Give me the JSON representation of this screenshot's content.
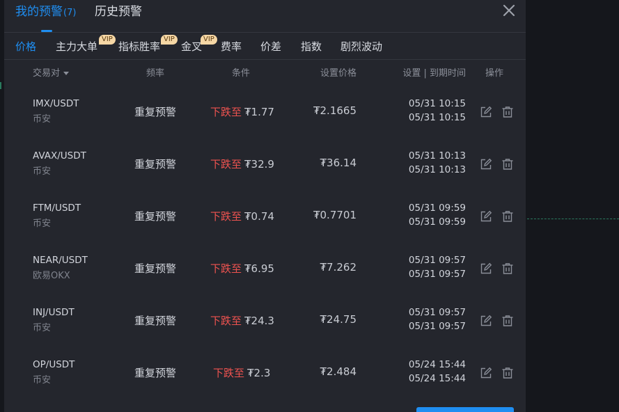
{
  "header": {
    "tabs": [
      {
        "label": "我的预警",
        "count": "(7)"
      },
      {
        "label": "历史预警"
      }
    ]
  },
  "subtabs": [
    {
      "label": "价格",
      "vip": ""
    },
    {
      "label": "主力大单",
      "vip": "VIP"
    },
    {
      "label": "指标胜率",
      "vip": "VIP"
    },
    {
      "label": "金叉",
      "vip": "VIP"
    },
    {
      "label": "费率",
      "vip": ""
    },
    {
      "label": "价差",
      "vip": ""
    },
    {
      "label": "指数",
      "vip": ""
    },
    {
      "label": "剧烈波动",
      "vip": ""
    }
  ],
  "columns": {
    "pair": "交易对",
    "frequency": "频率",
    "condition": "条件",
    "set_price": "设置价格",
    "time": "设置 | 到期时间",
    "action": "操作"
  },
  "rows": [
    {
      "pair": "IMX/USDT",
      "exchange": "币安",
      "frequency": "重复预警",
      "direction": "下跌至",
      "target": "₮1.77",
      "set_price": "₮2.1665",
      "set_time": "05/31 10:15",
      "expire_time": "05/31 10:15"
    },
    {
      "pair": "AVAX/USDT",
      "exchange": "币安",
      "frequency": "重复预警",
      "direction": "下跌至",
      "target": "₮32.9",
      "set_price": "₮36.14",
      "set_time": "05/31 10:13",
      "expire_time": "05/31 10:13"
    },
    {
      "pair": "FTM/USDT",
      "exchange": "币安",
      "frequency": "重复预警",
      "direction": "下跌至",
      "target": "₮0.74",
      "set_price": "₮0.7701",
      "set_time": "05/31 09:59",
      "expire_time": "05/31 09:59"
    },
    {
      "pair": "NEAR/USDT",
      "exchange": "欧易OKX",
      "frequency": "重复预警",
      "direction": "下跌至",
      "target": "₮6.95",
      "set_price": "₮7.262",
      "set_time": "05/31 09:57",
      "expire_time": "05/31 09:57"
    },
    {
      "pair": "INJ/USDT",
      "exchange": "币安",
      "frequency": "重复预警",
      "direction": "下跌至",
      "target": "₮24.3",
      "set_price": "₮24.75",
      "set_time": "05/31 09:57",
      "expire_time": "05/31 09:57"
    },
    {
      "pair": "OP/USDT",
      "exchange": "币安",
      "frequency": "重复预警",
      "direction": "下跌至",
      "target": "₮2.3",
      "set_price": "₮2.484",
      "set_time": "05/24 15:44",
      "expire_time": "05/24 15:44"
    }
  ],
  "icons": {
    "close": "close-icon",
    "edit": "edit-icon",
    "delete": "trash-icon",
    "sort": "caret-down-icon"
  },
  "colors": {
    "accent": "#1f8ef1",
    "down": "#ef5350",
    "vip_badge": "#f6d7a5",
    "panel": "#24262d"
  }
}
